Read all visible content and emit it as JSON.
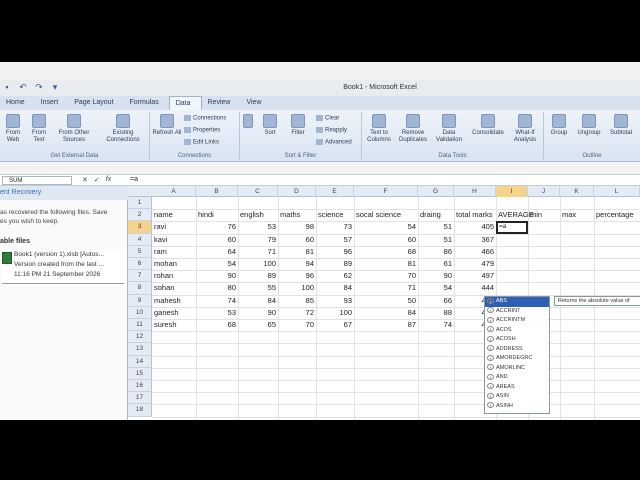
{
  "window": {
    "title": "Book1 - Microsoft Excel"
  },
  "tabs": [
    {
      "label": "Home"
    },
    {
      "label": "Insert"
    },
    {
      "label": "Page Layout"
    },
    {
      "label": "Formulas"
    },
    {
      "label": "Data",
      "active": true
    },
    {
      "label": "Review"
    },
    {
      "label": "View"
    }
  ],
  "ribbon": {
    "get_external": {
      "label": "Get External Data",
      "from_web": "From Web",
      "from_text": "From Text",
      "from_other": "From Other Sources",
      "existing": "Existing Connections"
    },
    "connections": {
      "label": "Connections",
      "refresh": "Refresh All",
      "connections": "Connections",
      "properties": "Properties",
      "edit_links": "Edit Links"
    },
    "sort_filter": {
      "label": "Sort & Filter",
      "sort": "Sort",
      "filter": "Filter",
      "clear": "Clear",
      "reapply": "Reapply",
      "advanced": "Advanced"
    },
    "data_tools": {
      "label": "Data Tools",
      "text_to_columns": "Text to Columns",
      "remove_duplicates": "Remove Duplicates",
      "data_validation": "Data Validation",
      "consolidate": "Consolidate",
      "what_if": "What-If Analysis"
    },
    "outline": {
      "label": "Outline",
      "group": "Group",
      "ungroup": "Ungroup",
      "subtotal": "Subtotal"
    }
  },
  "formula_bar": {
    "name_box": "SUM",
    "cancel": "✕",
    "enter": "✓",
    "fx": "fx",
    "formula": "=a"
  },
  "recovery": {
    "title": "ent Recovery",
    "message_line1": "as recovered the following files.  Save",
    "message_line2": "es you wish to keep.",
    "files_heading": "able files",
    "item_name": "Book1 (version 1).xlsb  [Autos...",
    "item_line2": "Version created from the last ...",
    "item_line3": "11:16 PM 21 September 2026"
  },
  "columns": [
    "A",
    "B",
    "C",
    "D",
    "E",
    "F",
    "G",
    "H",
    "I",
    "J",
    "K",
    "L"
  ],
  "rows": [
    "1",
    "2",
    "3",
    "4",
    "5",
    "6",
    "7",
    "8",
    "9",
    "10",
    "11",
    "12",
    "13",
    "14",
    "15",
    "16",
    "17",
    "18"
  ],
  "headers": [
    "name",
    "hindi",
    "english",
    "maths",
    "science",
    "socal science",
    "draing",
    "total marks",
    "AVERAGE",
    "min",
    "max",
    "percentage"
  ],
  "table": [
    {
      "name": "ravi",
      "hindi": "76",
      "english": "53",
      "maths": "98",
      "science": "73",
      "social": "54",
      "drawing": "51",
      "total": "405"
    },
    {
      "name": "kavi",
      "hindi": "60",
      "english": "79",
      "maths": "60",
      "science": "57",
      "social": "60",
      "drawing": "51",
      "total": "367"
    },
    {
      "name": "ram",
      "hindi": "64",
      "english": "71",
      "maths": "81",
      "science": "96",
      "social": "68",
      "drawing": "86",
      "total": "466"
    },
    {
      "name": "mohan",
      "hindi": "54",
      "english": "100",
      "maths": "94",
      "science": "89",
      "social": "81",
      "drawing": "61",
      "total": "479"
    },
    {
      "name": "rohan",
      "hindi": "90",
      "english": "89",
      "maths": "96",
      "science": "62",
      "social": "70",
      "drawing": "90",
      "total": "497"
    },
    {
      "name": "sohan",
      "hindi": "80",
      "english": "55",
      "maths": "100",
      "science": "84",
      "social": "71",
      "drawing": "54",
      "total": "444"
    },
    {
      "name": "mahesh",
      "hindi": "74",
      "english": "84",
      "maths": "85",
      "science": "93",
      "social": "50",
      "drawing": "66",
      "total": "452"
    },
    {
      "name": "ganesh",
      "hindi": "53",
      "english": "90",
      "maths": "72",
      "science": "100",
      "social": "84",
      "drawing": "88",
      "total": "487"
    },
    {
      "name": "suresh",
      "hindi": "68",
      "english": "65",
      "maths": "70",
      "science": "67",
      "social": "87",
      "drawing": "74",
      "total": "431"
    }
  ],
  "active_cell_text": "=a",
  "autocomplete": {
    "items": [
      "ABS",
      "ACCRINT",
      "ACCRINTM",
      "ACOS",
      "ACOSH",
      "ADDRESS",
      "AMORDEGRC",
      "AMORLINC",
      "AND",
      "AREAS",
      "ASIN",
      "ASINH"
    ],
    "tooltip": "Returns the absolute value of"
  }
}
